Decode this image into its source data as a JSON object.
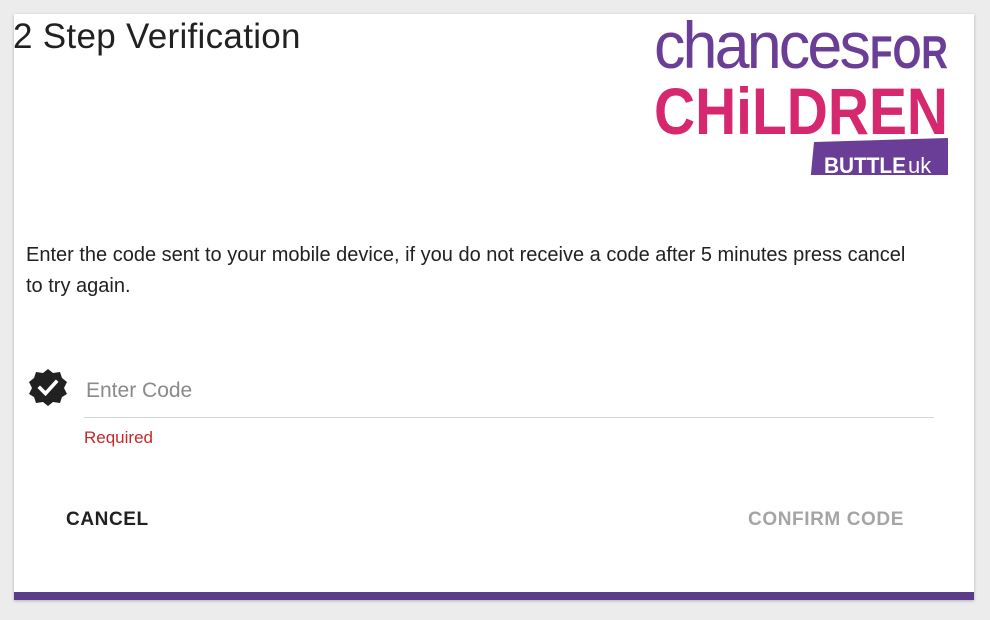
{
  "dialog": {
    "title": "2 Step Verification",
    "instructions": "Enter the code sent to your mobile device, if you do not receive a code after 5 minutes press cancel to try again.",
    "code_field": {
      "value": "",
      "placeholder": "Enter Code",
      "icon": "verified-badge-icon",
      "error": "Required"
    },
    "buttons": {
      "cancel_label": "CANCEL",
      "confirm_label": "CONFIRM CODE"
    }
  },
  "logo": {
    "line1_a": "chances",
    "line1_b": "FOR",
    "line2": "CHiLDREN",
    "badge": "BUTTLE",
    "badge_suffix": "uk"
  },
  "colors": {
    "accent_purple": "#5b3c88",
    "logo_purple": "#6a3d96",
    "logo_pink": "#d6286e",
    "error": "#c62828",
    "disabled_text": "#a5a5a5"
  }
}
